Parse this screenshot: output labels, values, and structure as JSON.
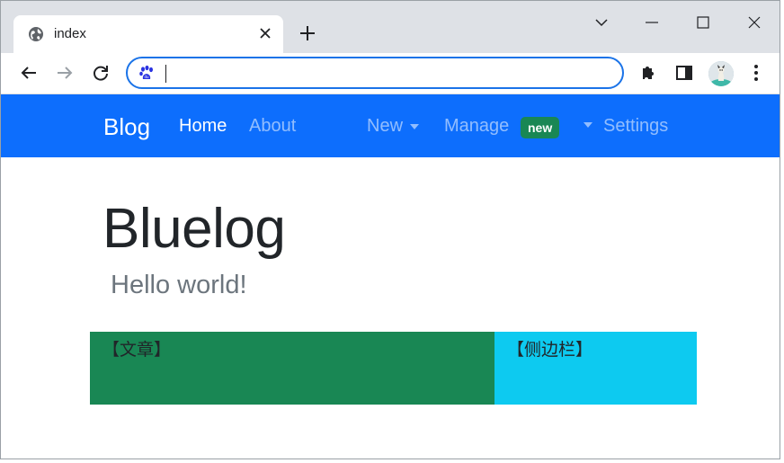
{
  "browser": {
    "tab_title": "index",
    "address_value": "",
    "address_placeholder": ""
  },
  "navbar": {
    "brand": "Blog",
    "links": [
      {
        "label": "Home",
        "active": true
      },
      {
        "label": "About",
        "active": false
      },
      {
        "label": "New",
        "active": false,
        "dropdown": true
      },
      {
        "label": "Manage",
        "active": false,
        "dropdown": true,
        "badge": "new"
      },
      {
        "label": "Settings",
        "active": false
      }
    ],
    "color": "#0d6efd"
  },
  "hero": {
    "title": "Bluelog",
    "subtitle": "Hello world!"
  },
  "layout": {
    "main_label": "【文章】",
    "sidebar_label": "【侧边栏】",
    "main_color": "#198754",
    "sidebar_color": "#0dcaf0"
  },
  "icons": {
    "tab_favicon": "globe-icon",
    "omnibox": "baidu-paw-icon",
    "extensions": "puzzle-icon",
    "side_panel": "side-panel-icon"
  }
}
